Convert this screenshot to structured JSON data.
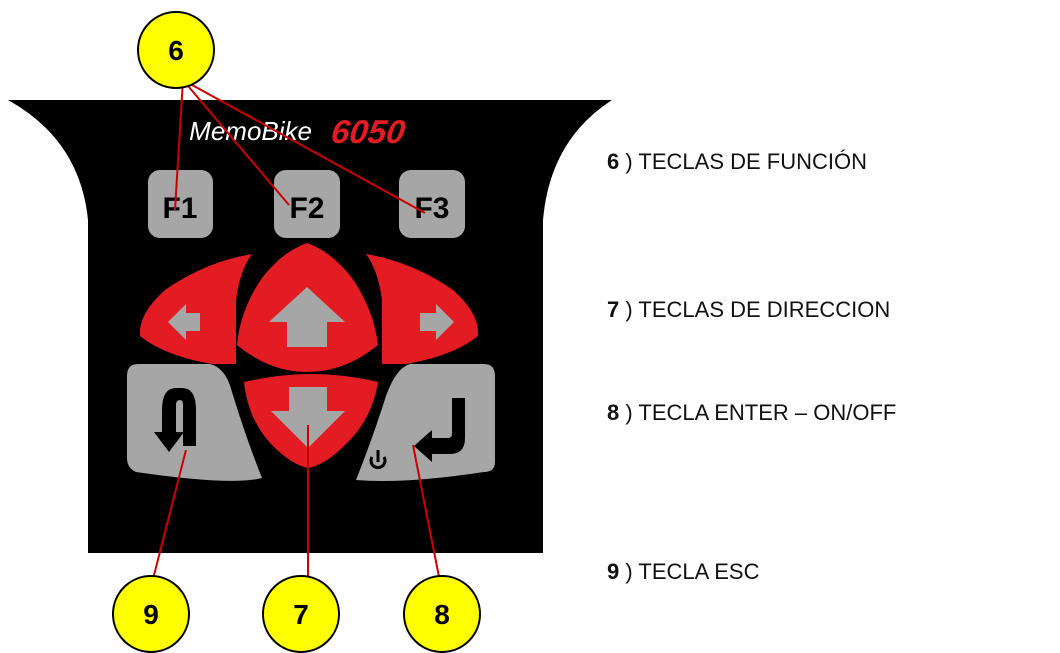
{
  "device": {
    "brand": "MemoBike",
    "model": "6050",
    "function_keys": [
      "F1",
      "F2",
      "F3"
    ]
  },
  "callouts": [
    {
      "number": "6"
    },
    {
      "number": "7"
    },
    {
      "number": "8"
    },
    {
      "number": "9"
    }
  ],
  "legend": [
    {
      "number": "6",
      "label": ") TECLAS DE FUNCIÓN"
    },
    {
      "number": "7",
      "label": ") TECLAS DE DIRECCION"
    },
    {
      "number": "8",
      "label": ") TECLA ENTER – ON/OFF"
    },
    {
      "number": "9",
      "label": ") TECLA ESC"
    }
  ],
  "colors": {
    "body": "#000000",
    "gray_key": "#a6a6a6",
    "red_key": "#ee1c24",
    "callout_fill": "#ffff00",
    "leader_line": "#cc0000"
  }
}
